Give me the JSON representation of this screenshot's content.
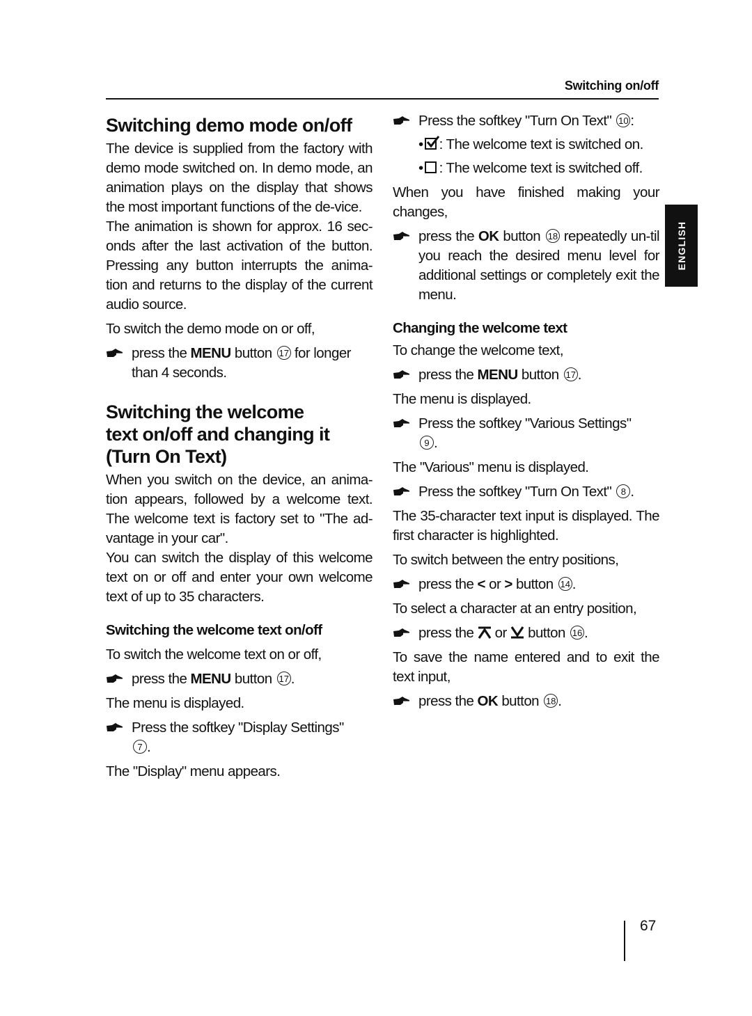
{
  "header": {
    "section_title": "Switching on/off"
  },
  "side_tab": {
    "label": "ENGLISH"
  },
  "footer": {
    "page_number": "67"
  },
  "left_column": {
    "demo": {
      "heading": "Switching demo mode on/off",
      "para1": "The device is supplied from the factory with demo mode switched on. In demo mode, an animation plays on the display that shows the most important functions of the de-vice.",
      "para2": "The animation is shown for approx. 16 sec-onds after the last activation of the button. Pressing any button interrupts the anima-tion and returns to the display of the current audio source.",
      "intro": "To switch the demo mode on or off,",
      "step": {
        "pre": "press the ",
        "key": "MENU",
        "mid": " button ",
        "num": "17",
        "post": " for longer than 4 seconds."
      }
    },
    "welcome": {
      "heading_line1": "Switching the welcome",
      "heading_line2": "text on/off and changing it",
      "heading_line3": "(Turn On Text)",
      "para1": "When you switch on the device, an anima-tion appears, followed by a welcome text. The welcome text is factory set to \"The ad-vantage in your car\".",
      "para2": "You can switch the display of this welcome text on or off and enter your own welcome text of up to 35 characters."
    },
    "onoff": {
      "heading": "Switching the welcome text on/off",
      "intro": "To switch the welcome text on or off,",
      "step1": {
        "pre": "press the ",
        "key": "MENU",
        "mid": " button ",
        "num": "17",
        "post": "."
      },
      "result1": "The menu is displayed.",
      "step2": {
        "text": "Press the softkey \"Display Settings\"",
        "num": "7",
        "post": "."
      },
      "result2": "The \"Display\" menu appears."
    }
  },
  "right_column": {
    "step_turn_on": {
      "text": "Press the softkey \"Turn On Text\" ",
      "num": "10",
      "post": ":"
    },
    "options": [
      {
        "state_icon": "checkbox-checked-icon",
        "text": ": The welcome text is switched on."
      },
      {
        "state_icon": "checkbox-empty-icon",
        "text": ": The welcome text is switched off."
      }
    ],
    "finish_intro": "When you have finished making your changes,",
    "finish_step": {
      "pre": "press the ",
      "key": "OK",
      "mid": " button ",
      "num": "18",
      "post": " repeatedly un-til you reach the desired menu level for additional settings or completely exit the menu."
    },
    "change": {
      "heading": "Changing the welcome text",
      "intro": "To change the welcome text,",
      "step1": {
        "pre": "press the ",
        "key": "MENU",
        "mid": " button ",
        "num": "17",
        "post": "."
      },
      "result1": "The menu is displayed.",
      "step2": {
        "text": "Press the softkey \"Various Settings\"",
        "num": "9",
        "post": "."
      },
      "result2": "The \"Various\" menu is displayed.",
      "step3": {
        "text": "Press the softkey \"Turn On Text\" ",
        "num": "8",
        "post": "."
      },
      "result3": "The 35-character text input is displayed. The first character is highlighted.",
      "positions_intro": "To switch between the entry positions,",
      "positions_step": {
        "pre": "press the ",
        "sym1": "<",
        "or": " or ",
        "sym2": ">",
        "mid": " button ",
        "num": "14",
        "post": "."
      },
      "select_intro": "To select a character at an entry position,",
      "select_step": {
        "pre": "press the ",
        "sym1_icon": "up-arrow-icon",
        "or": " or ",
        "sym2_icon": "down-arrow-icon",
        "mid": " button ",
        "num": "16",
        "post": "."
      },
      "save_intro": "To save the name entered and to exit the text input,",
      "save_step": {
        "pre": "press the ",
        "key": "OK",
        "mid": " button ",
        "num": "18",
        "post": "."
      }
    }
  }
}
